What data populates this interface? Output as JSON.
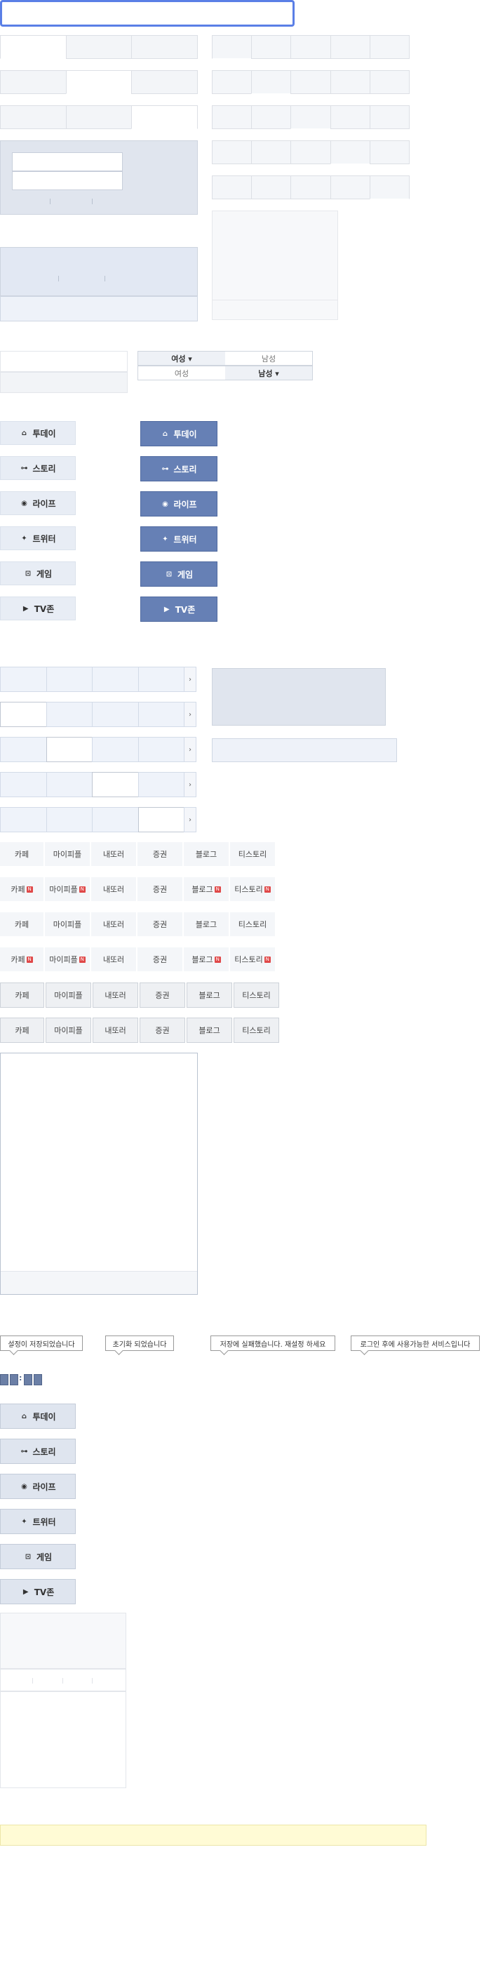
{
  "gender_selector": {
    "row1": {
      "female": "여성 ▾",
      "male": "남성"
    },
    "row2": {
      "female": "여성",
      "male": "남성 ▾"
    }
  },
  "nav_buttons": [
    {
      "label": "투데이",
      "icon": "home-icon",
      "glyph": "⌂"
    },
    {
      "label": "스토리",
      "icon": "story-icon",
      "glyph": "⊶"
    },
    {
      "label": "라이프",
      "icon": "eye-icon",
      "glyph": "◉"
    },
    {
      "label": "트위터",
      "icon": "twitter-icon",
      "glyph": "✦"
    },
    {
      "label": "게임",
      "icon": "gamepad-icon",
      "glyph": "⊡"
    },
    {
      "label": "TV존",
      "icon": "tv-icon",
      "glyph": "▶"
    }
  ],
  "services": [
    "카페",
    "마이피플",
    "내또러",
    "증권",
    "블로그",
    "티스토리"
  ],
  "new_badge": "N",
  "pager_arrow": "›",
  "tooltips": [
    "설정이 저장되었습니다",
    "초기화 되었습니다",
    "저장에 실패했습니다. 재설정 하세요",
    "로그인 후에 사용가능한 서비스입니다"
  ],
  "mini_time_separator": ":",
  "colors": {
    "accent": "#5a7fe6",
    "button_dark": "#6680b5",
    "badge": "#e04848",
    "notice": "#fffbd5"
  }
}
